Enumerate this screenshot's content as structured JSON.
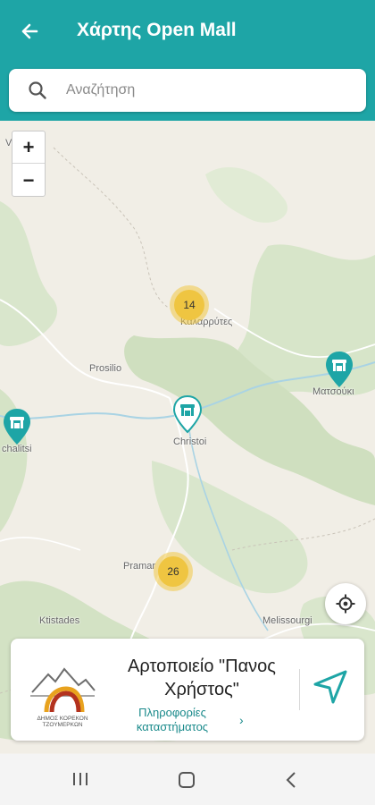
{
  "header": {
    "title": "Χάρτης Open Mall",
    "back_icon": "arrow-left-icon",
    "background": "#1ea5a6"
  },
  "search": {
    "placeholder": "Αναζήτηση",
    "icon": "search-icon"
  },
  "map": {
    "zoom_in_label": "+",
    "zoom_out_label": "−",
    "labels": {
      "vapordo": "Va     do",
      "kalarrytes": "Καλαρρύτες",
      "prosilio": "Prosilio",
      "christoi": "Christoi",
      "matsouki": "Ματσούκι",
      "michalitsi": "chalitsi",
      "pramanta": "Pramar",
      "ktistades": "Ktistades",
      "melissourgi": "Melissourgi"
    },
    "clusters": [
      {
        "count": "14"
      },
      {
        "count": "26"
      }
    ],
    "pin_icon": "store-pin-icon",
    "locate_icon": "crosshair-icon"
  },
  "store_card": {
    "name": "Αρτοποιείο \"Πανος Χρήστος\"",
    "info_link": "Πληροφορίες καταστήματος",
    "info_chevron": "›",
    "logo_text": "ΔΗΜΟΣ ΚΟΡΕΚΟΝ ΤΖΟΥΜΕΡΚΩΝ",
    "navigate_icon": "navigation-arrow-icon",
    "accent": "#1a8a8b"
  },
  "system_nav": {
    "recent_icon": "recent-apps-icon",
    "home_icon": "home-icon",
    "back_icon": "back-chevron-icon"
  }
}
